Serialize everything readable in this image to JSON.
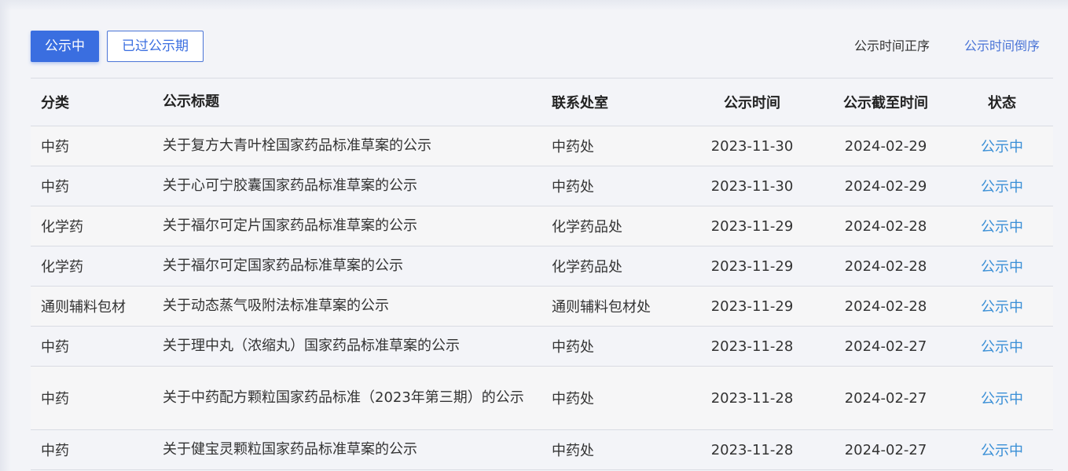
{
  "tabs": {
    "active_label": "公示中",
    "expired_label": "已过公示期"
  },
  "sort": {
    "asc_label": "公示时间正序",
    "desc_label": "公示时间倒序"
  },
  "table": {
    "headers": {
      "category": "分类",
      "title": "公示标题",
      "department": "联系处室",
      "publish_date": "公示时间",
      "end_date": "公示截至时间",
      "status": "状态"
    },
    "rows": [
      {
        "category": "中药",
        "title": "关于复方大青叶栓国家药品标准草案的公示",
        "department": "中药处",
        "publish_date": "2023-11-30",
        "end_date": "2024-02-29",
        "status": "公示中"
      },
      {
        "category": "中药",
        "title": "关于心可宁胶囊国家药品标准草案的公示",
        "department": "中药处",
        "publish_date": "2023-11-30",
        "end_date": "2024-02-29",
        "status": "公示中"
      },
      {
        "category": "化学药",
        "title": "关于福尔可定片国家药品标准草案的公示",
        "department": "化学药品处",
        "publish_date": "2023-11-29",
        "end_date": "2024-02-28",
        "status": "公示中"
      },
      {
        "category": "化学药",
        "title": "关于福尔可定国家药品标准草案的公示",
        "department": "化学药品处",
        "publish_date": "2023-11-29",
        "end_date": "2024-02-28",
        "status": "公示中"
      },
      {
        "category": "通则辅料包材",
        "title": "关于动态蒸气吸附法标准草案的公示",
        "department": "通则辅料包材处",
        "publish_date": "2023-11-29",
        "end_date": "2024-02-28",
        "status": "公示中"
      },
      {
        "category": "中药",
        "title": "关于理中丸（浓缩丸）国家药品标准草案的公示",
        "department": "中药处",
        "publish_date": "2023-11-28",
        "end_date": "2024-02-27",
        "status": "公示中"
      },
      {
        "category": "中药",
        "title": "关于中药配方颗粒国家药品标准（2023年第三期）的公示",
        "department": "中药处",
        "publish_date": "2023-11-28",
        "end_date": "2024-02-27",
        "status": "公示中"
      },
      {
        "category": "中药",
        "title": "关于健宝灵颗粒国家药品标准草案的公示",
        "department": "中药处",
        "publish_date": "2023-11-28",
        "end_date": "2024-02-27",
        "status": "公示中"
      }
    ]
  }
}
